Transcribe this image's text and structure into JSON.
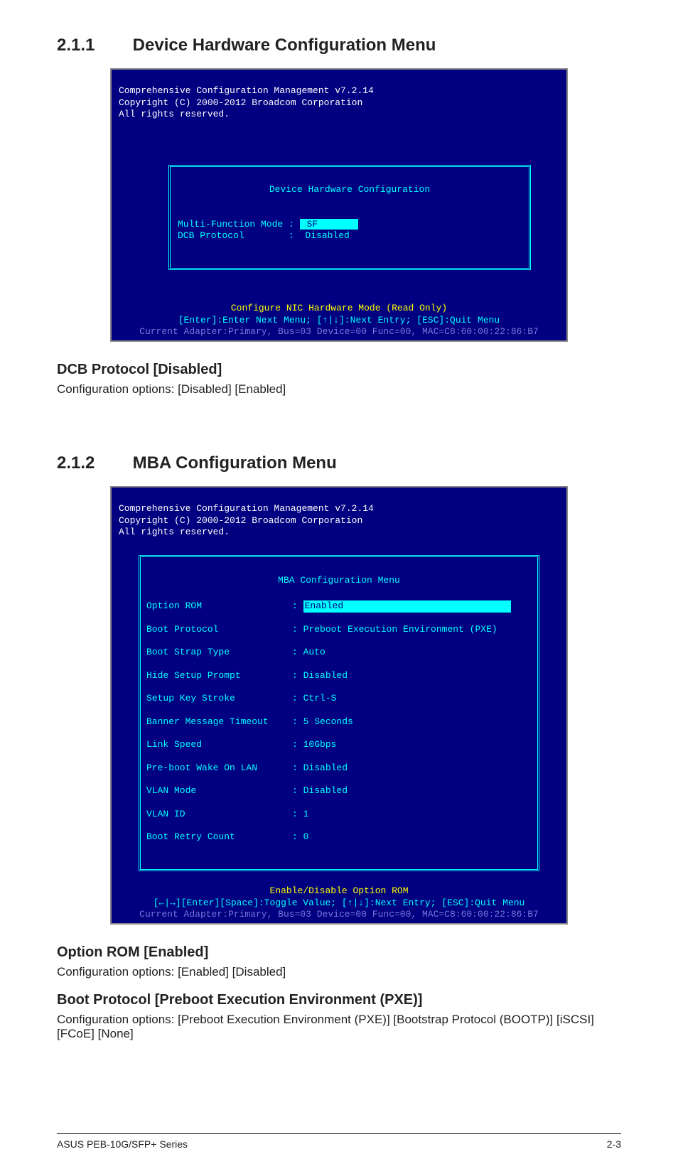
{
  "section1": {
    "num": "2.1.1",
    "title": "Device Hardware Configuration Menu"
  },
  "term_header": {
    "l1": "Comprehensive Configuration Management v7.2.14",
    "l2": "Copyright (C) 2000-2012 Broadcom Corporation",
    "l3": "All rights reserved."
  },
  "dhc": {
    "box_title": " Device Hardware Configuration ",
    "row1_label": "Multi-Function Mode :",
    "row1_value": " SF       ",
    "row2_label": "DCB Protocol        :",
    "row2_value": "  Disabled"
  },
  "dhc_footer": {
    "l1": "Configure NIC Hardware Mode (Read Only)",
    "l2": "[Enter]:Enter Next Menu; [↑|↓]:Next Entry; [ESC]:Quit Menu",
    "l3": "Current Adapter:Primary, Bus=03 Device=00 Func=00, MAC=C8:60:00:22:86:B7"
  },
  "dcb": {
    "h": "DCB Protocol [Disabled]",
    "p": "Configuration options: [Disabled] [Enabled]"
  },
  "section2": {
    "num": "2.1.2",
    "title": "MBA Configuration Menu"
  },
  "mba": {
    "box_title": " MBA Configuration Menu ",
    "rows": [
      {
        "label": "Option ROM",
        "value": "Enabled",
        "inv": true
      },
      {
        "label": "Boot Protocol",
        "value": "Preboot Execution Environment (PXE)"
      },
      {
        "label": "Boot Strap Type",
        "value": "Auto"
      },
      {
        "label": "Hide Setup Prompt",
        "value": "Disabled"
      },
      {
        "label": "Setup Key Stroke",
        "value": "Ctrl-S"
      },
      {
        "label": "Banner Message Timeout",
        "value": "5 Seconds"
      },
      {
        "label": "Link Speed",
        "value": "10Gbps"
      },
      {
        "label": "Pre-boot Wake On LAN",
        "value": "Disabled"
      },
      {
        "label": "VLAN Mode",
        "value": "Disabled"
      },
      {
        "label": "VLAN ID",
        "value": "1"
      },
      {
        "label": "Boot Retry Count",
        "value": "0"
      }
    ]
  },
  "mba_footer": {
    "l1": "Enable/Disable Option ROM",
    "l2": "[←|→][Enter][Space]:Toggle Value; [↑|↓]:Next Entry; [ESC]:Quit Menu",
    "l3": "Current Adapter:Primary, Bus=03 Device=00 Func=00, MAC=C8:60:00:22:86:B7"
  },
  "optrom": {
    "h": "Option ROM [Enabled]",
    "p": "Configuration options: [Enabled] [Disabled]"
  },
  "bootp": {
    "h": "Boot Protocol [Preboot Execution Environment (PXE)]",
    "p": "Configuration options: [Preboot Execution Environment (PXE)] [Bootstrap Protocol (BOOTP)] [iSCSI] [FCoE] [None]"
  },
  "footer": {
    "left": "ASUS PEB-10G/SFP+ Series",
    "right": "2-3"
  }
}
